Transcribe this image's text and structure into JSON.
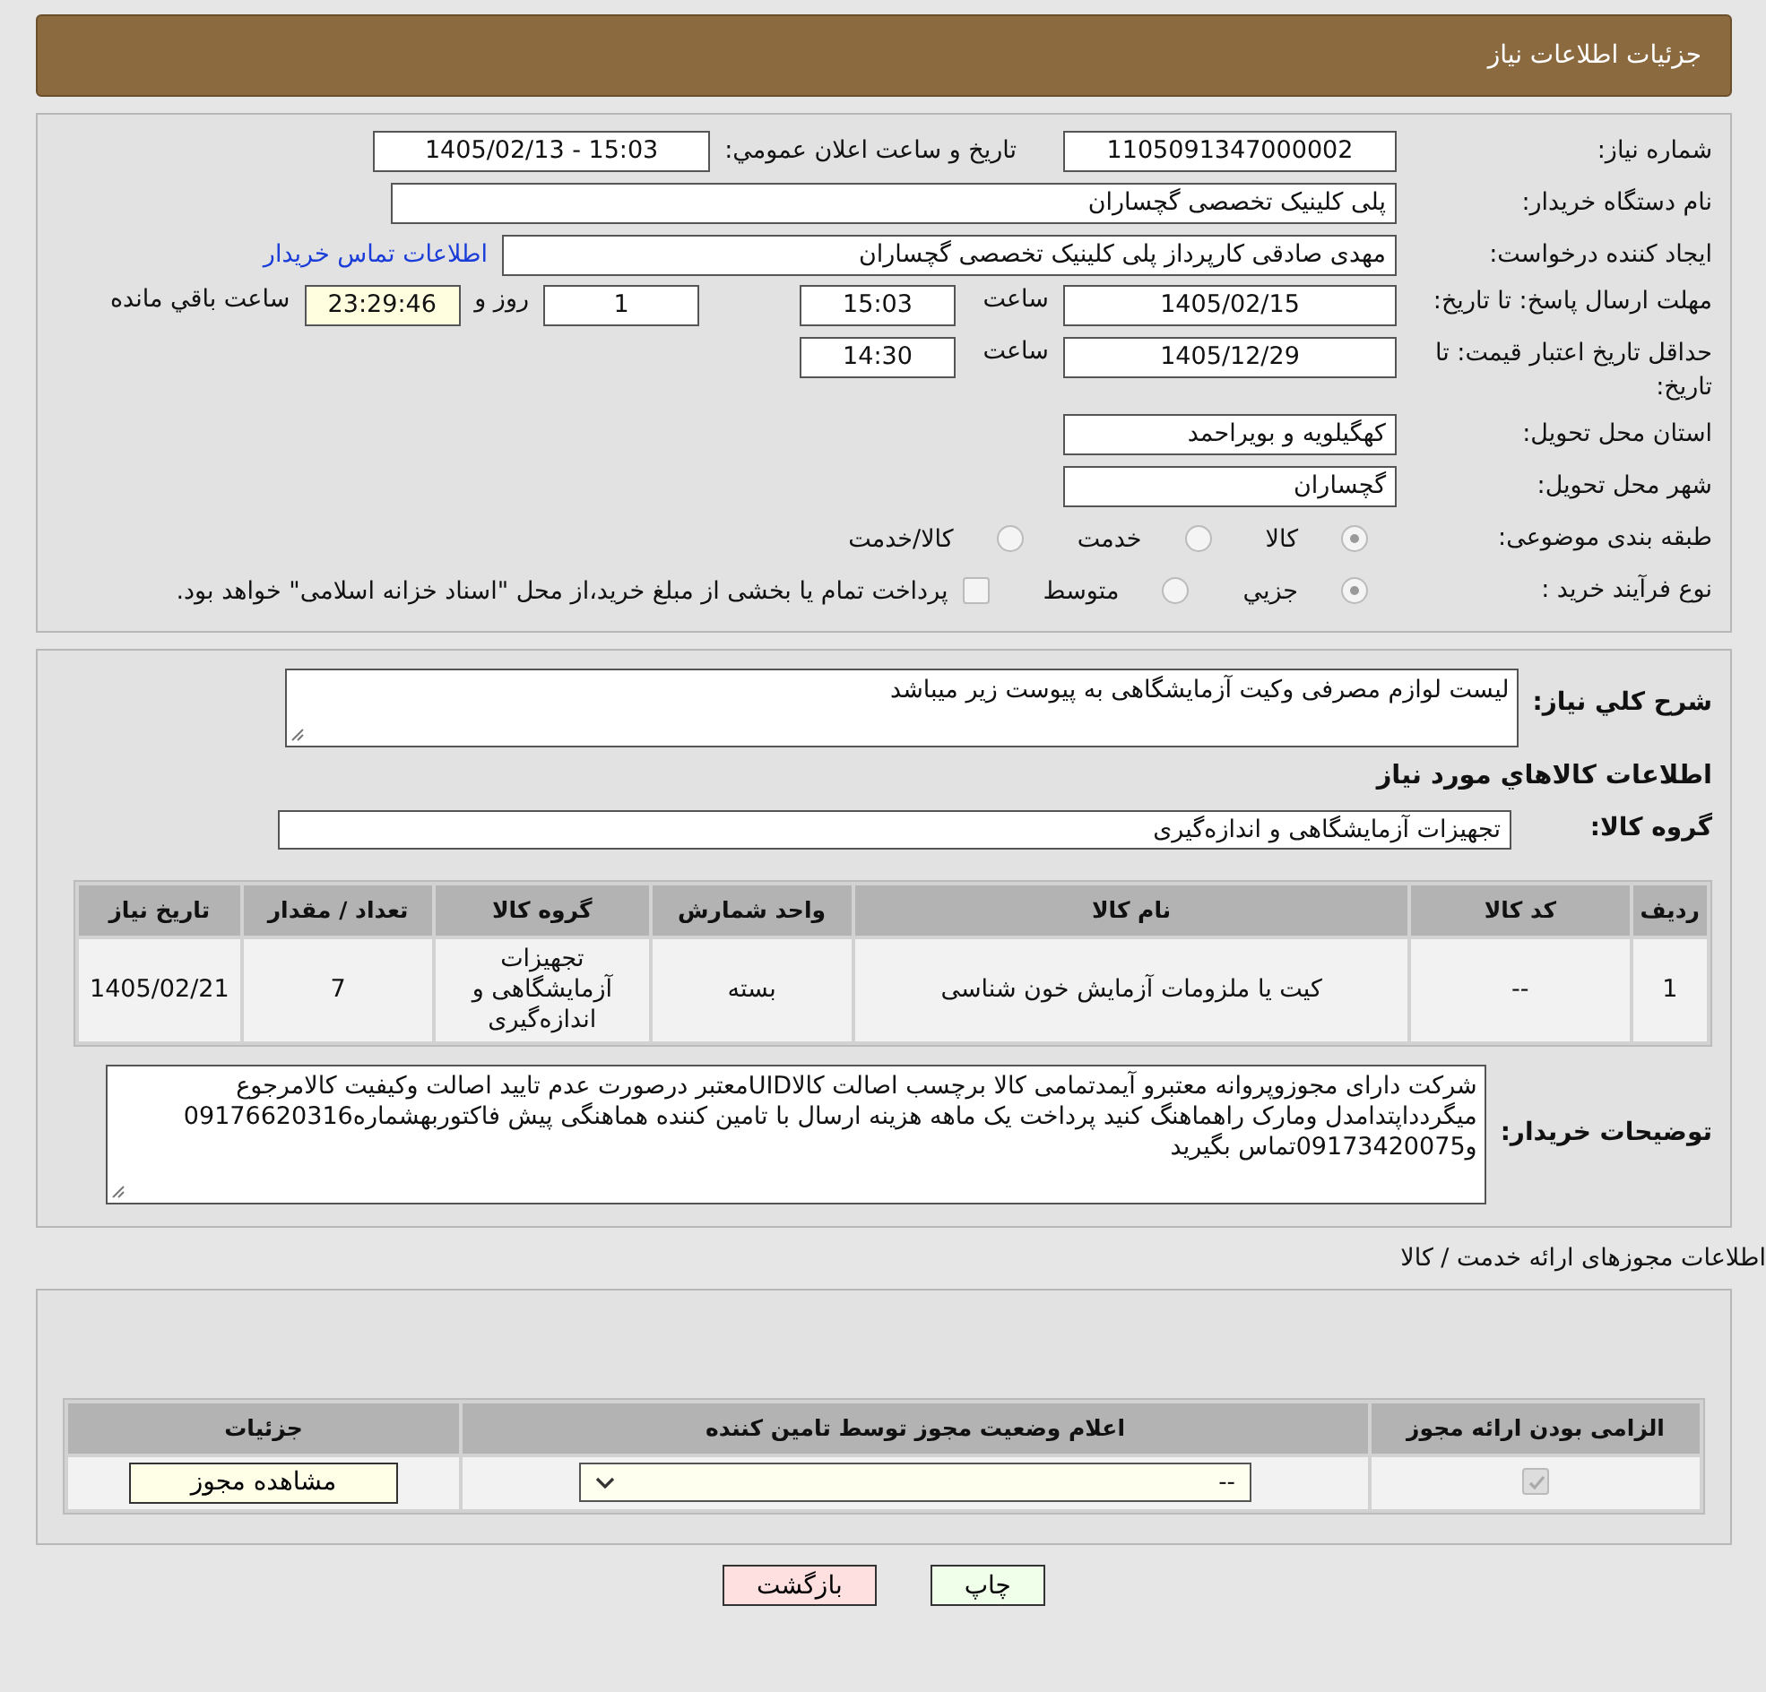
{
  "header": {
    "title": "جزئیات اطلاعات نیاز"
  },
  "details": {
    "need_number": {
      "label": "شماره نیاز:",
      "value": "1105091347000002"
    },
    "announce": {
      "label": "تاریخ و ساعت اعلان عمومي:",
      "value": "1405/02/13 - 15:03"
    },
    "buyer_org": {
      "label": "نام دستگاه خریدار:",
      "value": "پلی کلینیک تخصصی گچساران"
    },
    "requester": {
      "label": "ایجاد کننده درخواست:",
      "value": "مهدی صادقی کارپرداز پلی کلینیک تخصصی گچساران",
      "link": "اطلاعات تماس خریدار"
    },
    "reply_deadline": {
      "label": "مهلت ارسال پاسخ: تا تاریخ:",
      "date": "1405/02/15",
      "time_label": "ساعت",
      "time": "15:03",
      "days": "1",
      "days_label": "روز و",
      "remaining": "23:29:46",
      "remaining_label": "ساعت باقي مانده"
    },
    "price_validity": {
      "label": "حداقل تاریخ اعتبار قیمت: تا تاریخ:",
      "date": "1405/12/29",
      "time_label": "ساعت",
      "time": "14:30"
    },
    "province": {
      "label": "استان محل تحویل:",
      "value": "کهگیلویه و بویراحمد"
    },
    "city": {
      "label": "شهر محل تحویل:",
      "value": "گچساران"
    },
    "category": {
      "label": "طبقه بندی موضوعی:",
      "options": [
        {
          "label": "کالا",
          "selected": true
        },
        {
          "label": "خدمت",
          "selected": false
        },
        {
          "label": "کالا/خدمت",
          "selected": false
        }
      ]
    },
    "purchase_type": {
      "label": "نوع فرآیند خرید :",
      "options": [
        {
          "label": "جزيي",
          "selected": true
        },
        {
          "label": "متوسط",
          "selected": false
        }
      ],
      "note": {
        "label": "پرداخت تمام یا بخشی از مبلغ خرید،از محل \"اسناد خزانه اسلامی\" خواهد بود.",
        "checked": false
      }
    }
  },
  "needs": {
    "summary": {
      "label": "شرح کلي نياز:",
      "value": "لیست لوازم مصرفی وکیت آزمایشگاهی به پیوست زیر میباشد"
    },
    "section_title": "اطلاعات کالاهاي مورد نياز",
    "goods_group": {
      "label": "گروه کالا:",
      "value": "تجهیزات آزمایشگاهی و اندازه‌گیری"
    },
    "table": {
      "columns": [
        "ردیف",
        "کد کالا",
        "نام کالا",
        "واحد شمارش",
        "گروه کالا",
        "تعداد / مقدار",
        "تاریخ نیاز"
      ],
      "rows": [
        [
          "1",
          "--",
          "کیت یا ملزومات آزمایش خون شناسی",
          "بسته",
          "تجهیزات آزمایشگاهی و اندازه‌گیری",
          "7",
          "1405/02/21"
        ]
      ]
    },
    "buyer_notes": {
      "label": "توضیحات خریدار:",
      "value": "شرکت دارای مجوزوپروانه معتبرو آیمدتمامی کالا برچسب اصالت کالاUIDمعتبر درصورت عدم تایید اصالت وکیفیت کالامرجوع میگردداپتدامدل ومارک راهماهنگ کنید پرداخت یک ماهه هزینه ارسال با تامین کننده هماهنگی پیش فاکتوربهشماره09176620316 و09173420075تماس بگیرید"
    }
  },
  "permits": {
    "title": "اطلاعات مجوزهای ارائه خدمت / کالا",
    "columns": [
      "الزامی بودن ارائه مجوز",
      "اعلام وضعیت مجوز توسط تامین کننده",
      "جزئیات"
    ],
    "rows": [
      {
        "required": true,
        "status": "--",
        "action": "مشاهده مجوز"
      }
    ]
  },
  "buttons": [
    {
      "label": "چاپ",
      "kind": "print"
    },
    {
      "label": "بازگشت",
      "kind": "back"
    }
  ]
}
